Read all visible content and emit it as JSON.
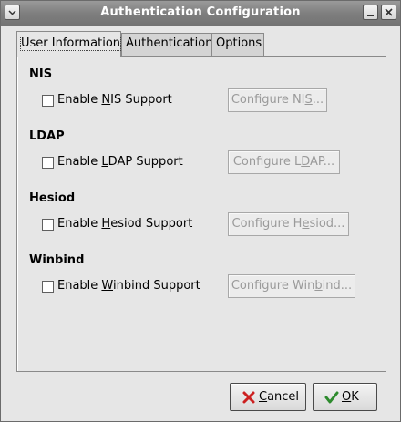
{
  "window": {
    "title": "Authentication Configuration"
  },
  "tabs": [
    {
      "label": "User Information",
      "active": true
    },
    {
      "label": "Authentication",
      "active": false
    },
    {
      "label": "Options",
      "active": false
    }
  ],
  "sections": [
    {
      "title": "NIS",
      "checkbox": {
        "pre": "Enable ",
        "mnemonic": "N",
        "post": "IS Support",
        "checked": false
      },
      "button": {
        "pre": "Configure NI",
        "mnemonic": "S",
        "post": "...",
        "enabled": false
      }
    },
    {
      "title": "LDAP",
      "checkbox": {
        "pre": "Enable ",
        "mnemonic": "L",
        "post": "DAP Support",
        "checked": false
      },
      "button": {
        "pre": "Configure L",
        "mnemonic": "D",
        "post": "AP...",
        "enabled": false
      }
    },
    {
      "title": "Hesiod",
      "checkbox": {
        "pre": "Enable ",
        "mnemonic": "H",
        "post": "esiod Support",
        "checked": false
      },
      "button": {
        "pre": "Configure H",
        "mnemonic": "e",
        "post": "siod...",
        "enabled": false
      }
    },
    {
      "title": "Winbind",
      "checkbox": {
        "pre": "Enable ",
        "mnemonic": "W",
        "post": "inbind Support",
        "checked": false
      },
      "button": {
        "pre": "Configure Win",
        "mnemonic": "b",
        "post": "ind...",
        "enabled": false
      }
    }
  ],
  "buttons": {
    "cancel": {
      "mnemonic": "C",
      "rest": "ancel",
      "icon": "cancel-x-icon"
    },
    "ok": {
      "mnemonic": "O",
      "rest": "K",
      "icon": "checkmark-icon"
    }
  },
  "colors": {
    "titlebar": "#808080",
    "background": "#e6e6e6",
    "cancel_icon": "#cc2020",
    "ok_icon": "#2e8b2e",
    "disabled_text": "#9a9a9a"
  }
}
